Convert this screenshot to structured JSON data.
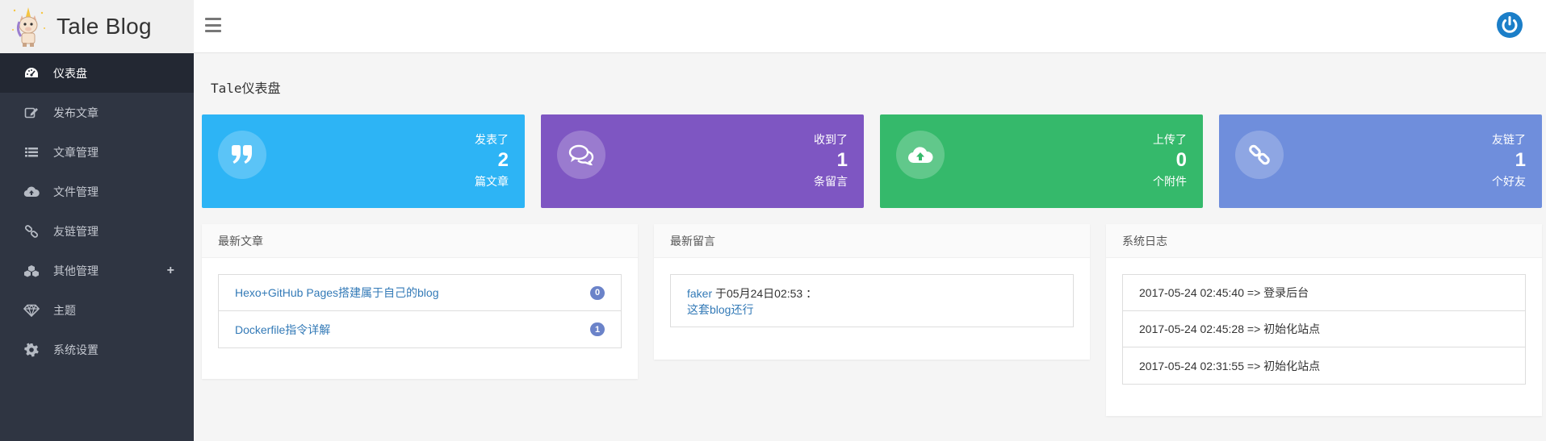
{
  "brand": {
    "title": "Tale Blog"
  },
  "sidebar": {
    "items": [
      {
        "label": "仪表盘",
        "icon": "dashboard-icon",
        "active": true
      },
      {
        "label": "发布文章",
        "icon": "edit-icon"
      },
      {
        "label": "文章管理",
        "icon": "list-icon"
      },
      {
        "label": "文件管理",
        "icon": "cloud-upload-icon"
      },
      {
        "label": "友链管理",
        "icon": "link-icon"
      },
      {
        "label": "其他管理",
        "icon": "cubes-icon",
        "expand": "+"
      },
      {
        "label": "主题",
        "icon": "diamond-icon"
      },
      {
        "label": "系统设置",
        "icon": "gear-icon"
      }
    ]
  },
  "main": {
    "title": "Tale仪表盘",
    "stats": [
      {
        "label": "发表了",
        "value": "2",
        "unit": "篇文章",
        "icon": "quote-icon",
        "color": "#2db4f5"
      },
      {
        "label": "收到了",
        "value": "1",
        "unit": "条留言",
        "icon": "comments-icon",
        "color": "#7e56c2"
      },
      {
        "label": "上传了",
        "value": "0",
        "unit": "个附件",
        "icon": "cloud-upload-icon",
        "color": "#35b96b"
      },
      {
        "label": "友链了",
        "value": "1",
        "unit": "个好友",
        "icon": "link-icon",
        "color": "#6f8edc"
      }
    ],
    "latest_posts": {
      "title": "最新文章",
      "items": [
        {
          "title": "Hexo+GitHub Pages搭建属于自己的blog",
          "count": "0"
        },
        {
          "title": "Dockerfile指令详解",
          "count": "1"
        }
      ]
    },
    "latest_comments": {
      "title": "最新留言",
      "items": [
        {
          "author": "faker",
          "meta": " 于05月24日02:53 ：",
          "content": "这套blog还行"
        }
      ]
    },
    "system_log": {
      "title": "系统日志",
      "items": [
        "2017-05-24 02:45:40 => 登录后台",
        "2017-05-24 02:45:28 => 初始化站点",
        "2017-05-24 02:31:55 => 初始化站点"
      ]
    }
  },
  "colors": {
    "sidebar": "#2f3542",
    "accent": "#1b7ec8",
    "link": "#337ab7"
  }
}
